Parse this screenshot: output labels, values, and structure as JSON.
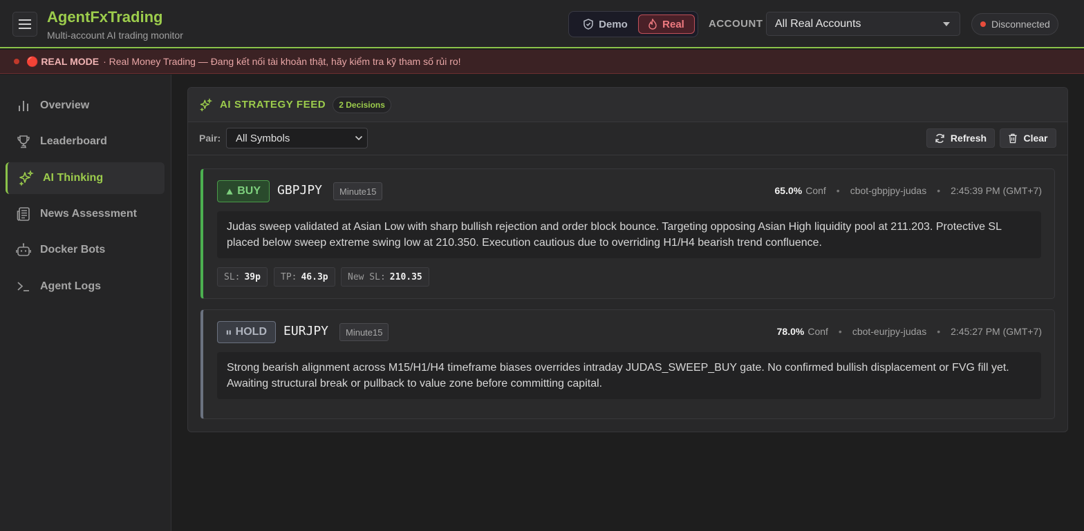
{
  "header": {
    "brand": "AgentFxTrading",
    "subtitle": "Multi-account AI trading monitor",
    "mode_demo": "Demo",
    "mode_real": "Real",
    "account_label": "ACCOUNT",
    "account_selected": "All Real Accounts",
    "connection_status": "Disconnected",
    "accent_color": "#8bc34a"
  },
  "warning": {
    "bold": "🔴 REAL MODE",
    "text": "· Real Money Trading — Đang kết nối tài khoản thật, hãy kiểm tra kỹ tham số rủi ro!"
  },
  "sidebar": {
    "items": [
      {
        "label": "Overview",
        "icon": "bar-chart-icon"
      },
      {
        "label": "Leaderboard",
        "icon": "trophy-icon"
      },
      {
        "label": "AI Thinking",
        "icon": "sparkles-icon",
        "active": true
      },
      {
        "label": "News Assessment",
        "icon": "newspaper-icon"
      },
      {
        "label": "Docker Bots",
        "icon": "bot-icon"
      },
      {
        "label": "Agent Logs",
        "icon": "terminal-icon"
      }
    ]
  },
  "feed": {
    "title": "AI STRATEGY FEED",
    "count": "2 Decisions",
    "pair_label": "Pair:",
    "pair_selected": "All Symbols",
    "refresh_label": "Refresh",
    "clear_label": "Clear",
    "decisions": [
      {
        "action": "BUY",
        "symbol": "GBPJPY",
        "timeframe": "Minute15",
        "confidence": "65.0%",
        "conf_label": "Conf",
        "bot": "cbot-gbpjpy-judas",
        "time": "2:45:39 PM (GMT+7)",
        "reason": "Judas sweep validated at Asian Low with sharp bullish rejection and order block bounce. Targeting opposing Asian High liquidity pool at 211.203. Protective SL placed below sweep extreme swing low at 210.350. Execution cautious due to overriding H1/H4 bearish trend confluence.",
        "chips": [
          {
            "k": "SL:",
            "v": "39p"
          },
          {
            "k": "TP:",
            "v": "46.3p"
          },
          {
            "k": "New SL:",
            "v": "210.35"
          }
        ]
      },
      {
        "action": "HOLD",
        "symbol": "EURJPY",
        "timeframe": "Minute15",
        "confidence": "78.0%",
        "conf_label": "Conf",
        "bot": "cbot-eurjpy-judas",
        "time": "2:45:27 PM (GMT+7)",
        "reason": "Strong bearish alignment across M15/H1/H4 timeframe biases overrides intraday JUDAS_SWEEP_BUY gate. No confirmed bullish displacement or FVG fill yet. Awaiting structural break or pullback to value zone before committing capital."
      }
    ]
  }
}
